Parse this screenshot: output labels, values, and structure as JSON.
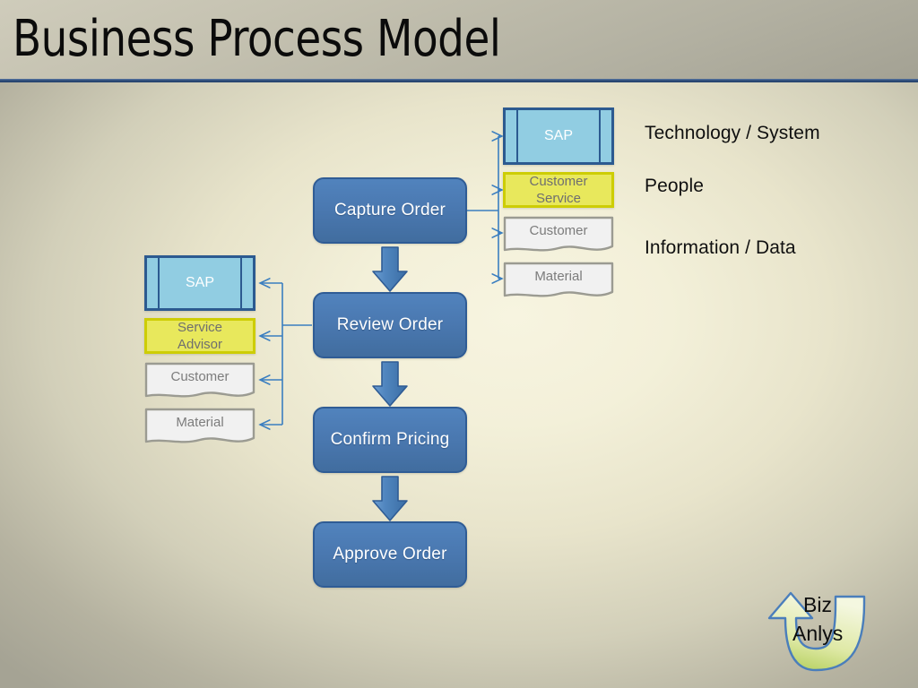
{
  "slide": {
    "title": "Business Process Model",
    "accent_rule_color": "#2e4d79",
    "background_center_color": "#f5f2dc",
    "background_edge_color": "#a5a394"
  },
  "process_flow": {
    "steps": [
      {
        "label": "Capture Order"
      },
      {
        "label": "Review Order"
      },
      {
        "label": "Confirm Pricing"
      },
      {
        "label": "Approve Order"
      }
    ],
    "box_fill_color": "#4a78b0",
    "box_border_color": "#2f5c95",
    "arrow_color": "#4a78b0"
  },
  "capture_order_resources": {
    "system": {
      "label": "SAP",
      "fill_color": "#91cde2",
      "border_color": "#2c5a90"
    },
    "people": {
      "label_line1": "Customer",
      "label_line2": "Service",
      "fill_color": "#e8e85c",
      "border_color": "#cdcd05"
    },
    "documents": [
      {
        "label": "Customer",
        "fill_color": "#f1f1f1",
        "border_color": "#9b9b92"
      },
      {
        "label": "Material",
        "fill_color": "#f1f1f1",
        "border_color": "#9b9b92"
      }
    ]
  },
  "review_order_resources": {
    "system": {
      "label": "SAP",
      "fill_color": "#91cde2",
      "border_color": "#2c5a90"
    },
    "people": {
      "label_line1": "Service",
      "label_line2": "Advisor",
      "fill_color": "#e8e85c",
      "border_color": "#cdcd05"
    },
    "documents": [
      {
        "label": "Customer",
        "fill_color": "#f1f1f1",
        "border_color": "#9b9b92"
      },
      {
        "label": "Material",
        "fill_color": "#f1f1f1",
        "border_color": "#9b9b92"
      }
    ]
  },
  "legend": {
    "items": [
      {
        "label": "Technology / System"
      },
      {
        "label": "People"
      },
      {
        "label": "Information / Data"
      }
    ]
  },
  "logo": {
    "word1": "Biz",
    "word2": "Anlys",
    "arrow_fill_start": "#eff3c8",
    "arrow_fill_end": "#c3d76a",
    "arrow_stroke": "#4a7ebb"
  }
}
